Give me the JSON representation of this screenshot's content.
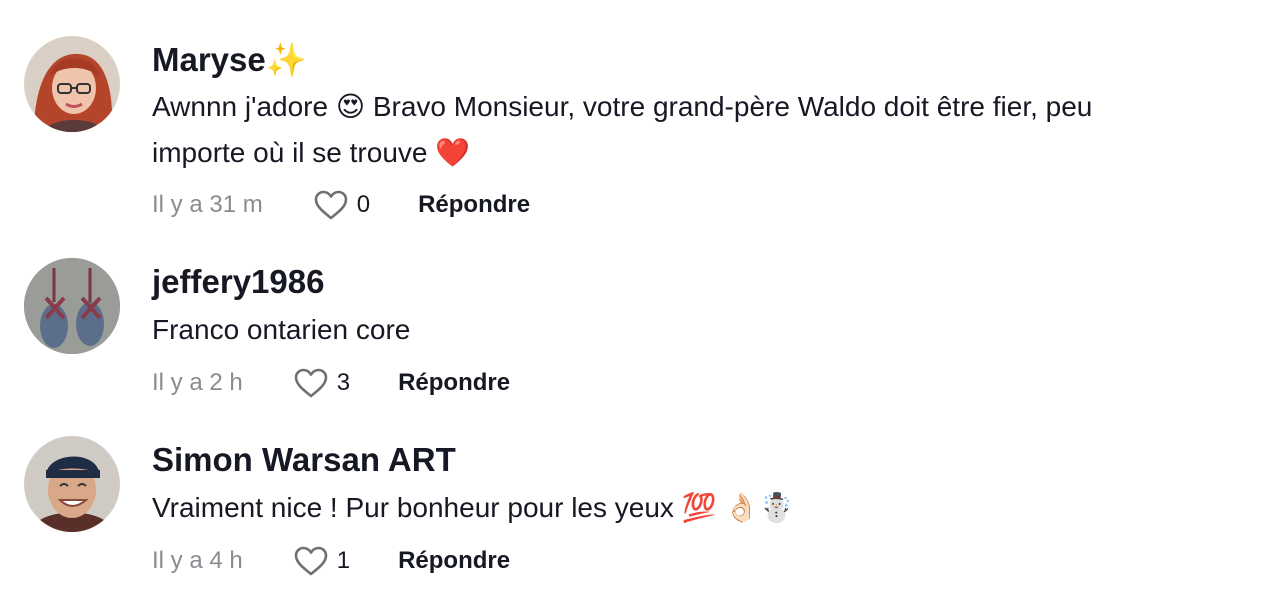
{
  "comments": [
    {
      "username": "Maryse",
      "username_emoji": "✨",
      "text_lines": [
        "Awnnn j'adore 😍 Bravo Monsieur, votre grand-père Waldo doit être fier, peu",
        "importe où il se trouve ❤️"
      ],
      "time": "Il y a 31 m",
      "likes": "0",
      "reply_label": "Répondre"
    },
    {
      "username": "jeffery1986",
      "text_lines": [
        "Franco ontarien core"
      ],
      "time": "Il y a 2 h",
      "likes": "3",
      "reply_label": "Répondre"
    },
    {
      "username": "Simon Warsan ART",
      "text_lines": [
        "Vraiment nice ! Pur bonheur pour les yeux 💯 👌🏻☃️"
      ],
      "time": "Il y a 4 h",
      "likes": "1",
      "reply_label": "Répondre"
    }
  ],
  "colors": {
    "text": "#161823",
    "muted": "#8a8b91",
    "sparkle": "#f5c542",
    "heart_emoji": "#e0202b"
  },
  "icons": {
    "like": "heart-outline-icon",
    "sparkle": "sparkles-icon"
  }
}
